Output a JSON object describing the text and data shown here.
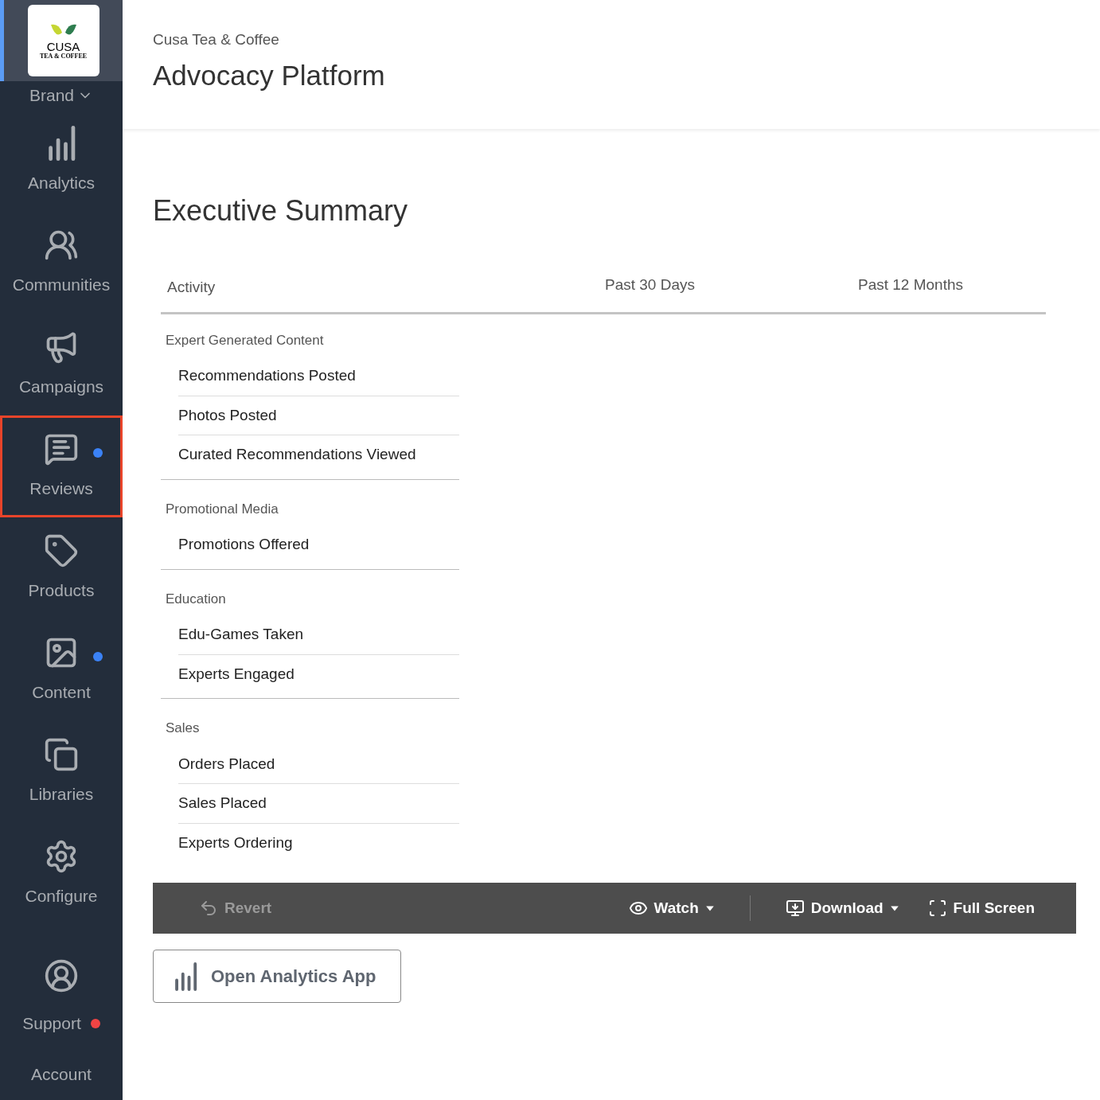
{
  "sidebar": {
    "logo": {
      "name": "CUSA",
      "tagline": "TEA & COFFEE"
    },
    "brand": "Brand",
    "items": [
      {
        "kind": "analytics",
        "label": "Analytics",
        "selected": false
      },
      {
        "kind": "communities",
        "label": "Communities",
        "selected": false
      },
      {
        "kind": "campaigns",
        "label": "Campaigns",
        "selected": false
      },
      {
        "kind": "reviews",
        "label": "Reviews",
        "selected": true,
        "color": "#3b82f6"
      },
      {
        "kind": "products",
        "label": "Products",
        "selected": false
      },
      {
        "kind": "content",
        "label": "Content",
        "selected": false,
        "color": "#3b82f6"
      },
      {
        "kind": "libraries",
        "label": "Libraries",
        "selected": false
      },
      {
        "kind": "configure",
        "label": "Configure",
        "selected": false
      },
      {
        "kind": "experts",
        "selected": false
      }
    ],
    "footer": [
      {
        "label": "Support",
        "color": "#ef4444"
      },
      {
        "label": "Account"
      }
    ]
  },
  "header": {
    "subtitle": "Cusa Tea & Coffee",
    "title": "Advocacy Platform"
  },
  "summary": {
    "title": "Executive Summary",
    "columns": [
      "Activity",
      "Past 30 Days",
      "Past 12 Months"
    ],
    "sections": [
      {
        "name": "Expert Generated Content",
        "rows": [
          "Recommendations Posted",
          "Photos Posted",
          "Curated Recommendations Viewed"
        ]
      },
      {
        "name": "Promotional Media",
        "rows": [
          "Promotions Offered"
        ]
      },
      {
        "name": "Education",
        "rows": [
          "Edu-Games Taken",
          "Experts Engaged"
        ]
      },
      {
        "name": "Sales",
        "rows": [
          "Orders Placed",
          "Sales Placed",
          "Experts Ordering"
        ]
      }
    ]
  },
  "toolbar": [
    {
      "kind": "revert",
      "label": "Revert",
      "disabled": true
    },
    {
      "kind": "watch",
      "label": "Watch",
      "disabled": false
    },
    {
      "kind": "download",
      "label": "Download",
      "disabled": false
    },
    {
      "kind": "fullscreen",
      "label": "Full Screen",
      "disabled": false
    }
  ],
  "open_app": "Open Analytics App"
}
